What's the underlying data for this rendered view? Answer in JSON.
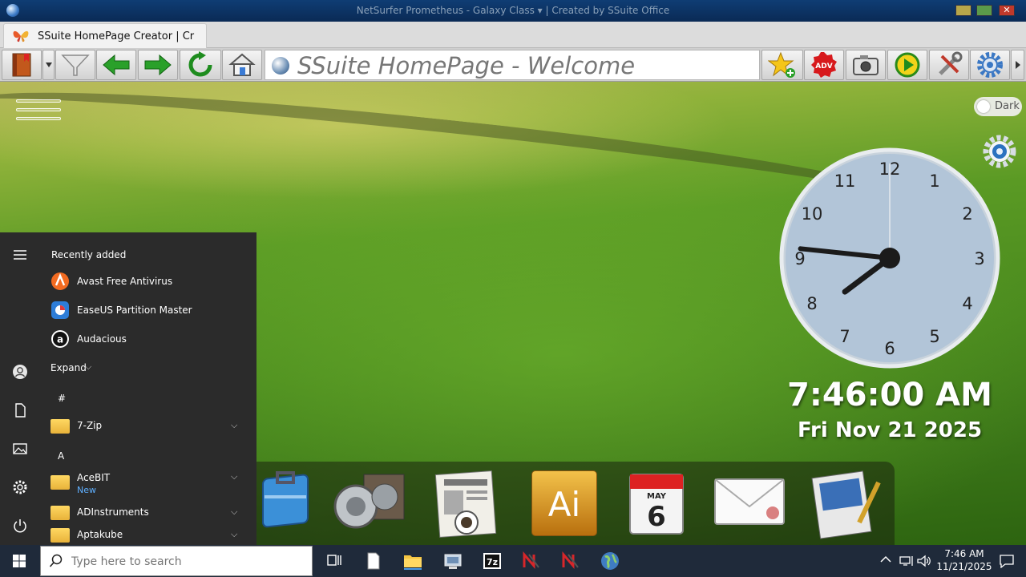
{
  "window": {
    "title": "NetSurfer Prometheus - Galaxy Class ▾  |  Created by SSuite Office"
  },
  "tab": {
    "label": "SSuite HomePage Creator | Cr"
  },
  "toolbar": {
    "address": "SSuite HomePage - Welcome",
    "adv_label": "ADV"
  },
  "desktop": {
    "dark_toggle_label": "Dark",
    "clock": {
      "numbers": [
        "12",
        "1",
        "2",
        "3",
        "4",
        "5",
        "6",
        "7",
        "8",
        "9",
        "10",
        "11"
      ],
      "time": "7:46:00 AM",
      "date": "Fri Nov 21 2025"
    },
    "dock_icons": [
      "briefcase-icon",
      "speaker-icon",
      "newspaper-icon",
      "illustrator-icon",
      "calendar-icon",
      "mail-icon",
      "notepad-icon"
    ],
    "calendar_icon": {
      "month": "MAY",
      "day": "6"
    },
    "illustrator_icon_text": "Ai"
  },
  "start_menu": {
    "recently_added_label": "Recently added",
    "recent": [
      {
        "label": "Avast Free Antivirus",
        "color": "#f26b21"
      },
      {
        "label": "EaseUS Partition Master",
        "color": "#2e7dd7"
      },
      {
        "label": "Audacious",
        "color": "#111111",
        "glyph": "a"
      }
    ],
    "expand_label": "Expand",
    "sections": [
      {
        "letter": "#",
        "items": [
          {
            "label": "7-Zip",
            "sub": ""
          }
        ]
      },
      {
        "letter": "A",
        "items": [
          {
            "label": "AceBIT",
            "sub": "New"
          },
          {
            "label": "ADInstruments",
            "sub": ""
          },
          {
            "label": "Aptakube",
            "sub": ""
          }
        ]
      }
    ]
  },
  "taskbar": {
    "search_placeholder": "Type here to search",
    "tray_time": "7:46 AM",
    "tray_date": "11/21/2025",
    "seven_zip_label": "7z"
  }
}
